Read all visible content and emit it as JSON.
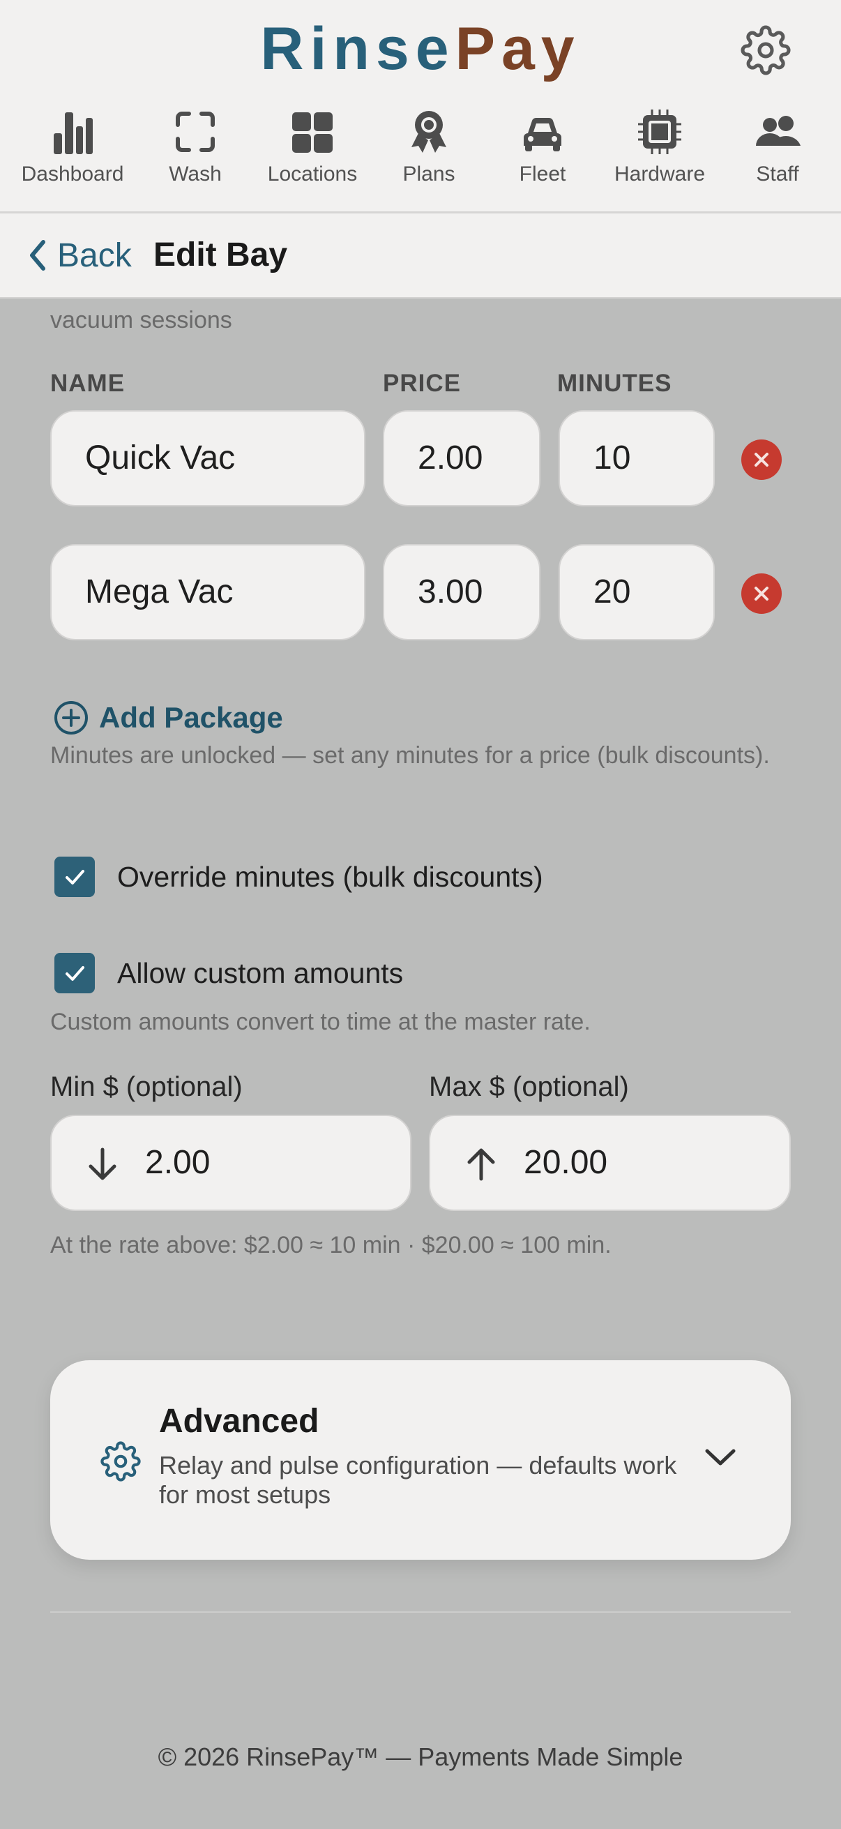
{
  "header": {
    "brand_part1": "Rinse",
    "brand_part2": "Pay",
    "settings_icon": "gear-icon"
  },
  "nav": [
    {
      "label": "Dashboard",
      "icon": "bar-chart-icon"
    },
    {
      "label": "Wash",
      "icon": "scan-frame-icon"
    },
    {
      "label": "Locations",
      "icon": "grid-icon"
    },
    {
      "label": "Plans",
      "icon": "award-ribbon-icon"
    },
    {
      "label": "Fleet",
      "icon": "car-icon"
    },
    {
      "label": "Hardware",
      "icon": "chip-icon"
    },
    {
      "label": "Staff",
      "icon": "users-icon"
    }
  ],
  "backbar": {
    "back_label": "Back",
    "title": "Edit Bay"
  },
  "intro": {
    "text": "vacuum sessions"
  },
  "packages": {
    "headers": {
      "name": "NAME",
      "price": "PRICE",
      "minutes": "MINUTES"
    },
    "rows": [
      {
        "name": "Quick Vac",
        "price": "2.00",
        "minutes": "10"
      },
      {
        "name": "Mega Vac",
        "price": "3.00",
        "minutes": "20"
      }
    ],
    "add_label": "Add Package",
    "help": "Minutes are unlocked — set any minutes for a price (bulk discounts)."
  },
  "options": {
    "override_label": "Override minutes (bulk discounts)",
    "override_checked": true,
    "custom_label": "Allow custom amounts",
    "custom_checked": true,
    "custom_help": "Custom amounts convert to time at the master rate."
  },
  "amounts": {
    "min_label": "Min $ (optional)",
    "min_value": "2.00",
    "max_label": "Max $ (optional)",
    "max_value": "20.00",
    "rate_note": "At the rate above: $2.00 ≈ 10 min · $20.00 ≈ 100 min."
  },
  "advanced": {
    "title": "Advanced",
    "subtitle": "Relay and pulse configuration — defaults work for most setups"
  },
  "footer": {
    "text": "© 2026 RinsePay™ — Payments Made Simple"
  },
  "colors": {
    "brand_primary": "#28607a",
    "brand_accent": "#7a4226",
    "danger": "#c63a2f",
    "checkbox": "#2d6178"
  }
}
